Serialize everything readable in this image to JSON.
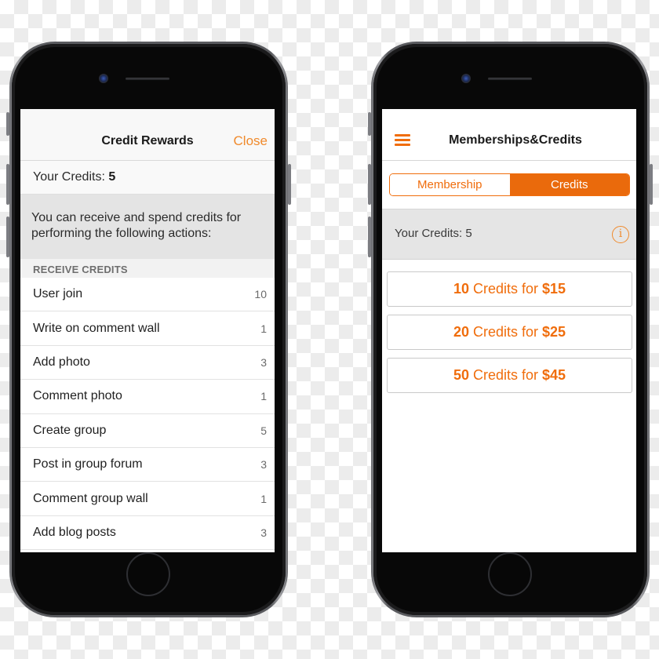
{
  "left_phone": {
    "screen": {
      "nav": {
        "title": "Credit Rewards",
        "close_label": "Close"
      },
      "credits": {
        "label": "Your Credits:",
        "value": "5"
      },
      "info_text": "You can receive and spend credits for performing the following actions:",
      "section_header": "RECEIVE CREDITS",
      "rewards": [
        {
          "action": "User join",
          "credits": "10"
        },
        {
          "action": "Write on comment wall",
          "credits": "1"
        },
        {
          "action": "Add photo",
          "credits": "3"
        },
        {
          "action": "Comment photo",
          "credits": "1"
        },
        {
          "action": "Create group",
          "credits": "5"
        },
        {
          "action": "Post in group forum",
          "credits": "3"
        },
        {
          "action": "Comment group wall",
          "credits": "1"
        },
        {
          "action": "Add blog posts",
          "credits": "3"
        }
      ]
    }
  },
  "right_phone": {
    "screen": {
      "nav": {
        "menu_icon": "hamburger-menu-icon",
        "title": "Memberships&Credits"
      },
      "tabs": [
        {
          "label": "Membership",
          "active": false
        },
        {
          "label": "Credits",
          "active": true
        }
      ],
      "credits": {
        "text": "Your Credits: 5",
        "info_icon": "info-icon",
        "info_glyph": "i"
      },
      "packages": [
        {
          "amount": "10",
          "middle": "Credits for",
          "price": "$15"
        },
        {
          "amount": "20",
          "middle": "Credits for",
          "price": "$25"
        },
        {
          "amount": "50",
          "middle": "Credits for",
          "price": "$45"
        }
      ]
    }
  },
  "colors": {
    "accent": "#f06d0c",
    "accent_light": "#f08a2c",
    "phone_bezel": "#080808",
    "phone_frame": "#5a5b5f"
  }
}
